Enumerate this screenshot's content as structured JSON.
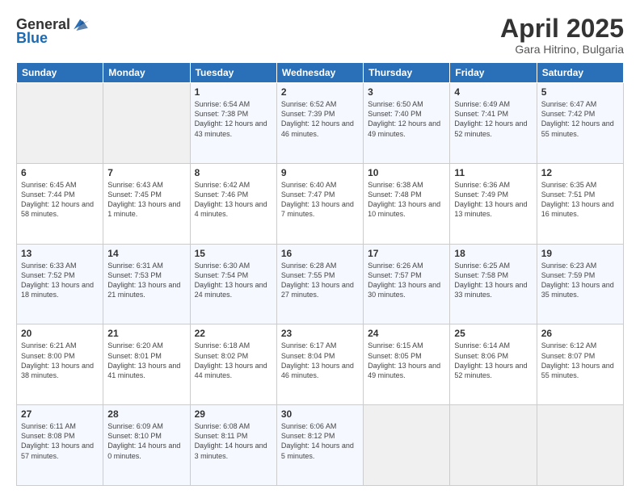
{
  "header": {
    "logo_general": "General",
    "logo_blue": "Blue",
    "month": "April 2025",
    "location": "Gara Hitrino, Bulgaria"
  },
  "days_of_week": [
    "Sunday",
    "Monday",
    "Tuesday",
    "Wednesday",
    "Thursday",
    "Friday",
    "Saturday"
  ],
  "weeks": [
    [
      {
        "day": "",
        "info": ""
      },
      {
        "day": "",
        "info": ""
      },
      {
        "day": "1",
        "info": "Sunrise: 6:54 AM\nSunset: 7:38 PM\nDaylight: 12 hours and 43 minutes."
      },
      {
        "day": "2",
        "info": "Sunrise: 6:52 AM\nSunset: 7:39 PM\nDaylight: 12 hours and 46 minutes."
      },
      {
        "day": "3",
        "info": "Sunrise: 6:50 AM\nSunset: 7:40 PM\nDaylight: 12 hours and 49 minutes."
      },
      {
        "day": "4",
        "info": "Sunrise: 6:49 AM\nSunset: 7:41 PM\nDaylight: 12 hours and 52 minutes."
      },
      {
        "day": "5",
        "info": "Sunrise: 6:47 AM\nSunset: 7:42 PM\nDaylight: 12 hours and 55 minutes."
      }
    ],
    [
      {
        "day": "6",
        "info": "Sunrise: 6:45 AM\nSunset: 7:44 PM\nDaylight: 12 hours and 58 minutes."
      },
      {
        "day": "7",
        "info": "Sunrise: 6:43 AM\nSunset: 7:45 PM\nDaylight: 13 hours and 1 minute."
      },
      {
        "day": "8",
        "info": "Sunrise: 6:42 AM\nSunset: 7:46 PM\nDaylight: 13 hours and 4 minutes."
      },
      {
        "day": "9",
        "info": "Sunrise: 6:40 AM\nSunset: 7:47 PM\nDaylight: 13 hours and 7 minutes."
      },
      {
        "day": "10",
        "info": "Sunrise: 6:38 AM\nSunset: 7:48 PM\nDaylight: 13 hours and 10 minutes."
      },
      {
        "day": "11",
        "info": "Sunrise: 6:36 AM\nSunset: 7:49 PM\nDaylight: 13 hours and 13 minutes."
      },
      {
        "day": "12",
        "info": "Sunrise: 6:35 AM\nSunset: 7:51 PM\nDaylight: 13 hours and 16 minutes."
      }
    ],
    [
      {
        "day": "13",
        "info": "Sunrise: 6:33 AM\nSunset: 7:52 PM\nDaylight: 13 hours and 18 minutes."
      },
      {
        "day": "14",
        "info": "Sunrise: 6:31 AM\nSunset: 7:53 PM\nDaylight: 13 hours and 21 minutes."
      },
      {
        "day": "15",
        "info": "Sunrise: 6:30 AM\nSunset: 7:54 PM\nDaylight: 13 hours and 24 minutes."
      },
      {
        "day": "16",
        "info": "Sunrise: 6:28 AM\nSunset: 7:55 PM\nDaylight: 13 hours and 27 minutes."
      },
      {
        "day": "17",
        "info": "Sunrise: 6:26 AM\nSunset: 7:57 PM\nDaylight: 13 hours and 30 minutes."
      },
      {
        "day": "18",
        "info": "Sunrise: 6:25 AM\nSunset: 7:58 PM\nDaylight: 13 hours and 33 minutes."
      },
      {
        "day": "19",
        "info": "Sunrise: 6:23 AM\nSunset: 7:59 PM\nDaylight: 13 hours and 35 minutes."
      }
    ],
    [
      {
        "day": "20",
        "info": "Sunrise: 6:21 AM\nSunset: 8:00 PM\nDaylight: 13 hours and 38 minutes."
      },
      {
        "day": "21",
        "info": "Sunrise: 6:20 AM\nSunset: 8:01 PM\nDaylight: 13 hours and 41 minutes."
      },
      {
        "day": "22",
        "info": "Sunrise: 6:18 AM\nSunset: 8:02 PM\nDaylight: 13 hours and 44 minutes."
      },
      {
        "day": "23",
        "info": "Sunrise: 6:17 AM\nSunset: 8:04 PM\nDaylight: 13 hours and 46 minutes."
      },
      {
        "day": "24",
        "info": "Sunrise: 6:15 AM\nSunset: 8:05 PM\nDaylight: 13 hours and 49 minutes."
      },
      {
        "day": "25",
        "info": "Sunrise: 6:14 AM\nSunset: 8:06 PM\nDaylight: 13 hours and 52 minutes."
      },
      {
        "day": "26",
        "info": "Sunrise: 6:12 AM\nSunset: 8:07 PM\nDaylight: 13 hours and 55 minutes."
      }
    ],
    [
      {
        "day": "27",
        "info": "Sunrise: 6:11 AM\nSunset: 8:08 PM\nDaylight: 13 hours and 57 minutes."
      },
      {
        "day": "28",
        "info": "Sunrise: 6:09 AM\nSunset: 8:10 PM\nDaylight: 14 hours and 0 minutes."
      },
      {
        "day": "29",
        "info": "Sunrise: 6:08 AM\nSunset: 8:11 PM\nDaylight: 14 hours and 3 minutes."
      },
      {
        "day": "30",
        "info": "Sunrise: 6:06 AM\nSunset: 8:12 PM\nDaylight: 14 hours and 5 minutes."
      },
      {
        "day": "",
        "info": ""
      },
      {
        "day": "",
        "info": ""
      },
      {
        "day": "",
        "info": ""
      }
    ]
  ]
}
